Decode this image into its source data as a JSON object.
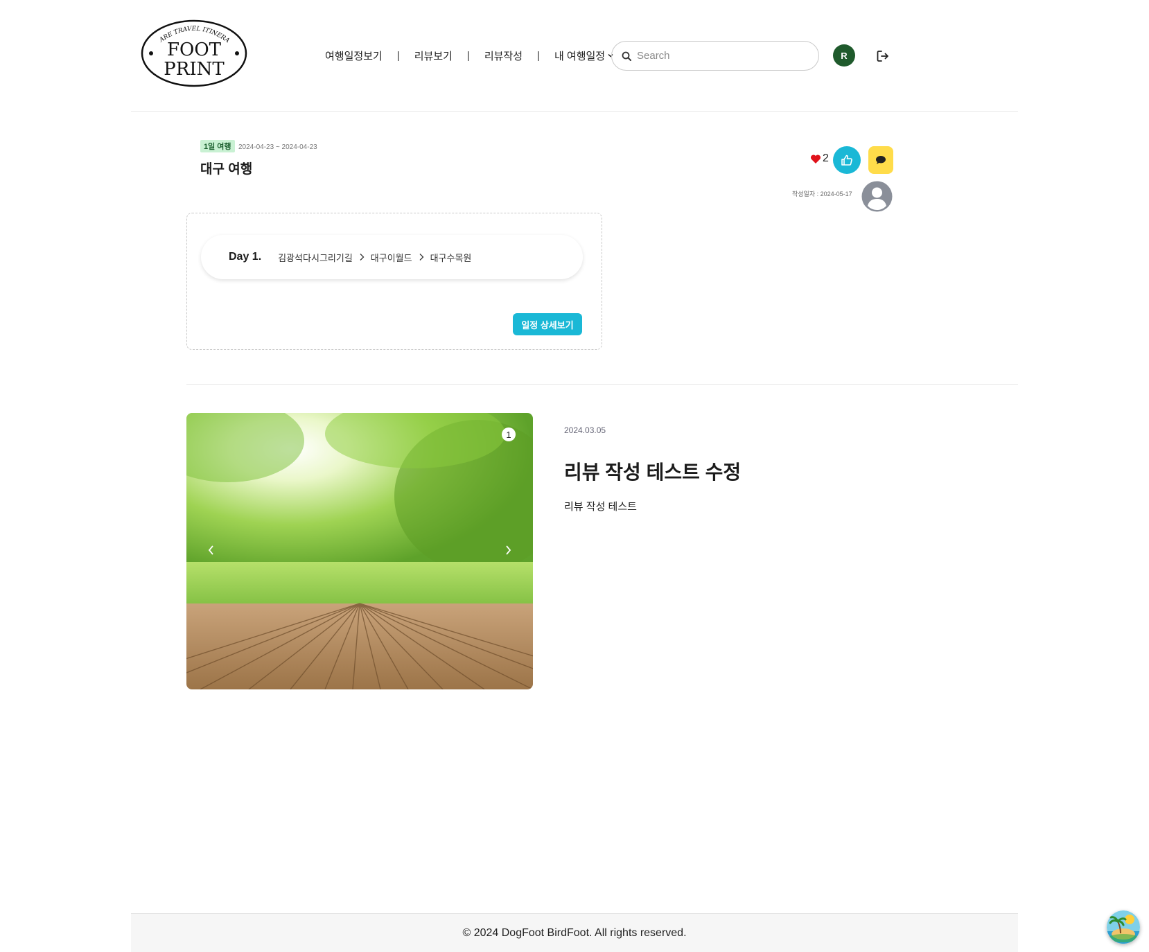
{
  "header": {
    "logo": {
      "top_text": "SHARE TRAVEL ITINERARY",
      "line1": "FOOT",
      "line2": "PRINT"
    },
    "nav": [
      {
        "label": "여행일정보기"
      },
      {
        "label": "리뷰보기"
      },
      {
        "label": "리뷰작성"
      },
      {
        "label": "내 여행일정"
      }
    ],
    "separator": "|",
    "search": {
      "placeholder": "Search",
      "value": ""
    },
    "user_initial": "R",
    "user_avatar_color": "#1f5a2c"
  },
  "trip": {
    "badge": "1일 여행",
    "dates": "2024-04-23 ~ 2024-04-23",
    "title": "대구 여행",
    "likes": "2",
    "written_date": "작성일자 : 2024-05-17",
    "accent_color": "#1ab8d6",
    "comment_color": "#ffdc4a",
    "days": [
      {
        "label": "Day 1.",
        "stops": [
          "김광석다시그리기길",
          "대구이월드",
          "대구수목원"
        ]
      }
    ],
    "detail_button": "일정 상세보기"
  },
  "review": {
    "image_counter": "1",
    "date": "2024.03.05",
    "title": "리뷰 작성 테스트 수정",
    "body": "리뷰 작성 테스트"
  },
  "footer": {
    "copyright": "© 2024 DogFoot BirdFoot. All rights reserved."
  }
}
